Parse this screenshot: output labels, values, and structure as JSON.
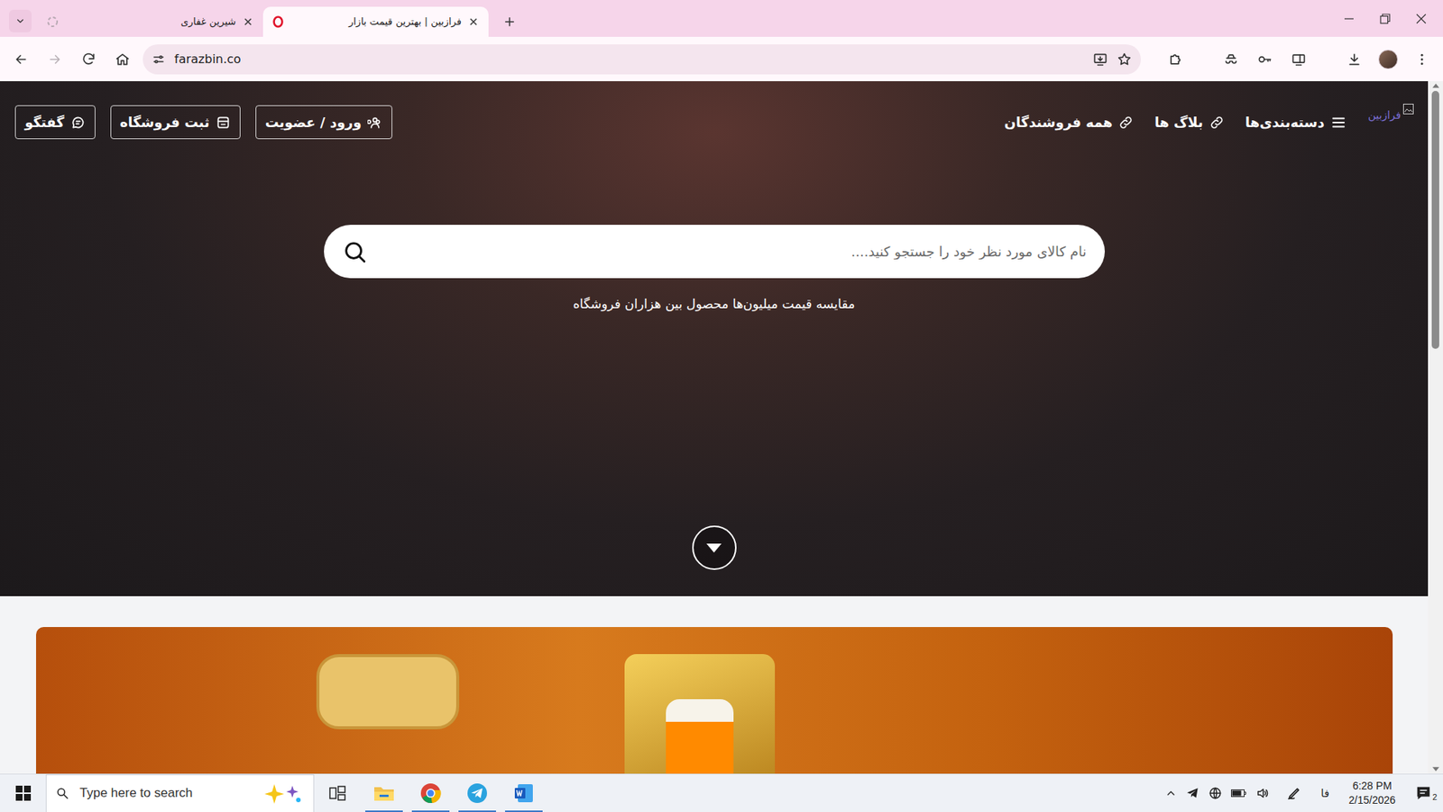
{
  "browser": {
    "tabs": [
      {
        "label": "شیرین غفاری",
        "selected": false
      },
      {
        "label": "فرازبین | بهترین قیمت بازار",
        "selected": true
      }
    ],
    "address": "farazbin.co"
  },
  "site": {
    "logo_alt": "فرازبین",
    "nav": [
      "دسته‌بندی‌ها",
      "بلاگ ها",
      "همه فروشندگان"
    ],
    "actions": [
      "ورود / عضویت",
      "ثبت فروشگاه",
      "گفتگو"
    ],
    "search": {
      "placeholder": "نام کالای مورد نظر خود را جستجو کنید...."
    },
    "tagline": "مقایسه قیمت میلیون‌ها محصول بین هزاران فروشگاه"
  },
  "taskbar": {
    "search_placeholder": "Type here to search",
    "language": "فا",
    "time": "6:28 PM",
    "date": "2/15/2026",
    "notifications": "2"
  }
}
